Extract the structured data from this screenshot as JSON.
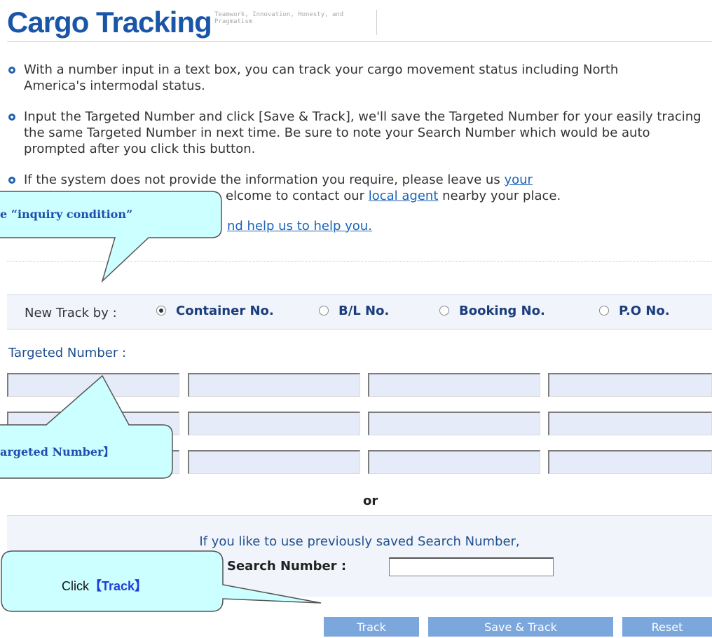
{
  "header": {
    "title": "Cargo Tracking",
    "tagline": "Teamwork, Innovation, Honesty, and Pragmatism"
  },
  "instructions": [
    {
      "text": "With a number input in a text box, you can track your cargo movement status including North America's intermodal status."
    },
    {
      "text": "Input the Targeted Number and click [Save & Track], we'll save the Targeted Number for your easily tracing the same Targeted Number in next time. Be sure to note your Search Number which would be auto prompted after you click this button."
    },
    {
      "prefix": "If the system does not provide the information you require, please leave us ",
      "link1": "your",
      "line2_visible": "elcome to contact our ",
      "link2": "local agent",
      "suffix": " nearby your place.",
      "line3_link": "nd help us to help you."
    }
  ],
  "track_by": {
    "label": "New Track by :",
    "selected": "Container No.",
    "options": [
      "Container No.",
      "B/L No.",
      "Booking No.",
      "P.O No."
    ]
  },
  "targeted_number": {
    "label": "Targeted Number :"
  },
  "or_label": "or",
  "saved_search": {
    "prompt": "If you like to use previously saved Search Number,",
    "label": "Search Number :"
  },
  "buttons": {
    "track": "Track",
    "save_track": "Save & Track",
    "reset": "Reset"
  },
  "callouts": {
    "inquiry": "e “inquiry condition”",
    "targeted": "argeted Number】",
    "click_prefix": "Click",
    "click_bold": "【Track】"
  },
  "colors": {
    "brand": "#1a56a8",
    "link": "#1a63b8",
    "button": "#7ba7dd",
    "callout_fill": "#ccffff",
    "field_fill": "#e5ebf8"
  }
}
